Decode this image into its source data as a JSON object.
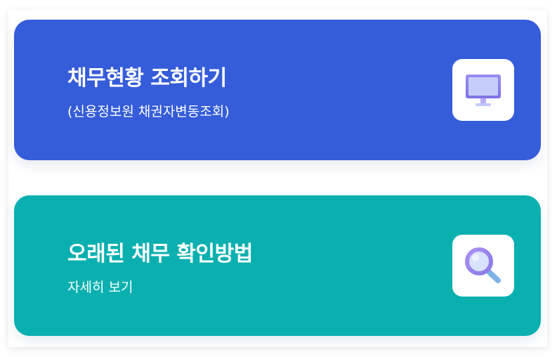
{
  "cards": [
    {
      "title": "채무현황 조회하기",
      "subtitle": "(신용정보원 채권자변동조회)",
      "icon": "monitor-icon",
      "color": "#355cd9"
    },
    {
      "title": "오래된 채무 확인방법",
      "subtitle": "자세히 보기",
      "icon": "magnifier-icon",
      "color": "#0ab0b0"
    }
  ]
}
